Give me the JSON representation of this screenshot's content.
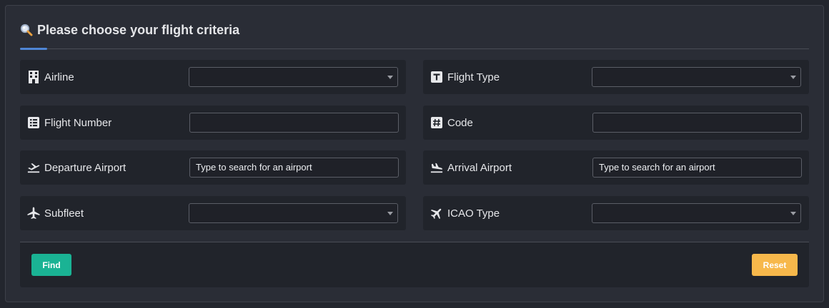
{
  "header": {
    "title": "Please choose your flight criteria",
    "icon": "magnifier-icon"
  },
  "fields": {
    "airline": {
      "label": "Airline",
      "icon": "building-icon",
      "value": ""
    },
    "flight_type": {
      "label": "Flight Type",
      "icon": "t-square-icon",
      "value": ""
    },
    "flight_number": {
      "label": "Flight Number",
      "icon": "list-icon",
      "value": ""
    },
    "code": {
      "label": "Code",
      "icon": "hash-icon",
      "value": ""
    },
    "departure_airport": {
      "label": "Departure Airport",
      "icon": "plane-departure-icon",
      "value": "Type to search for an airport"
    },
    "arrival_airport": {
      "label": "Arrival Airport",
      "icon": "plane-arrival-icon",
      "value": "Type to search for an airport"
    },
    "subfleet": {
      "label": "Subfleet",
      "icon": "plane-icon",
      "value": ""
    },
    "icao_type": {
      "label": "ICAO Type",
      "icon": "plane-tilted-icon",
      "value": ""
    }
  },
  "buttons": {
    "find": "Find",
    "reset": "Reset"
  },
  "colors": {
    "accent": "#4f86d6",
    "find": "#1ab394",
    "reset": "#f7b84b",
    "background": "#2a2d36"
  }
}
